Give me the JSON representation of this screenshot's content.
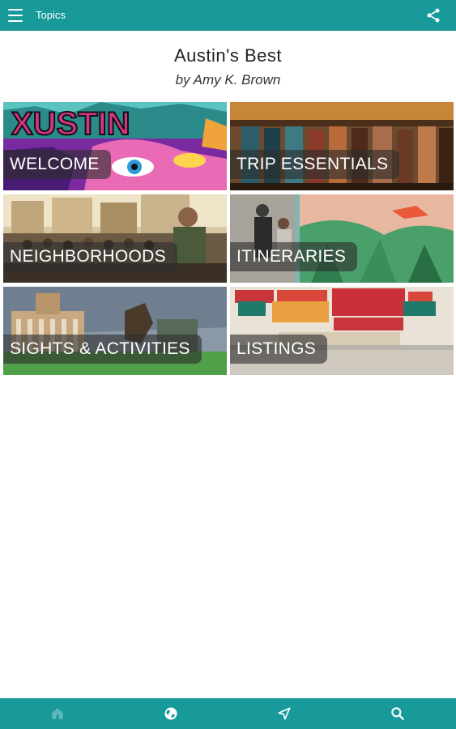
{
  "appbar": {
    "title": "Topics",
    "menu_icon": "menu-icon",
    "share_icon": "share-icon",
    "color": "#199a9a"
  },
  "header": {
    "title": "Austin's Best",
    "author": "by Amy K. Brown"
  },
  "tiles": [
    {
      "label": "WELCOME",
      "image": "graffiti-mural-eye"
    },
    {
      "label": "TRIP ESSENTIALS",
      "image": "cowboy-boots-shelf"
    },
    {
      "label": "NEIGHBORHOODS",
      "image": "street-crowd"
    },
    {
      "label": "ITINERARIES",
      "image": "mural-walkers"
    },
    {
      "label": "SIGHTS & ACTIVITIES",
      "image": "capitol-statue"
    },
    {
      "label": "LISTINGS",
      "image": "austin-texas-sign-wall"
    }
  ],
  "bottombar": {
    "icons": [
      "home-icon",
      "globe-icon",
      "navigation-icon",
      "search-icon"
    ]
  }
}
